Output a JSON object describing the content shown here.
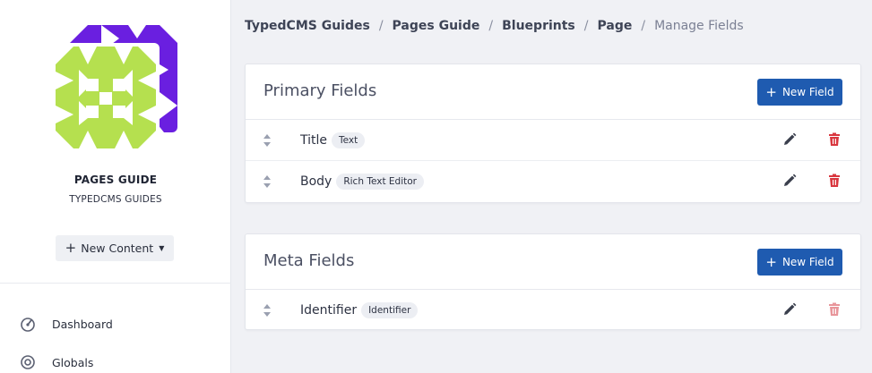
{
  "sidebar": {
    "site_name": "PAGES GUIDE",
    "site_subtitle": "TYPEDCMS GUIDES",
    "new_content_label": "New Content",
    "nav": [
      {
        "label": "Dashboard",
        "icon": "gauge-icon"
      },
      {
        "label": "Globals",
        "icon": "globe-icon"
      }
    ]
  },
  "breadcrumb": {
    "items": [
      "TypedCMS Guides",
      "Pages Guide",
      "Blueprints",
      "Page"
    ],
    "separator": "/",
    "current": "Manage Fields"
  },
  "primary_fields": {
    "title": "Primary Fields",
    "new_field_label": "New Field",
    "fields": [
      {
        "name": "Title",
        "type": "Text"
      },
      {
        "name": "Body",
        "type": "Rich Text Editor"
      }
    ]
  },
  "meta_fields": {
    "title": "Meta Fields",
    "new_field_label": "New Field",
    "fields": [
      {
        "name": "Identifier",
        "type": "Identifier"
      }
    ]
  },
  "colors": {
    "accent": "#1f5bb0",
    "danger": "#d9363e",
    "danger_muted": "#e8959a",
    "logo_front": "#b5e04f",
    "logo_back": "#6a1fe0"
  }
}
